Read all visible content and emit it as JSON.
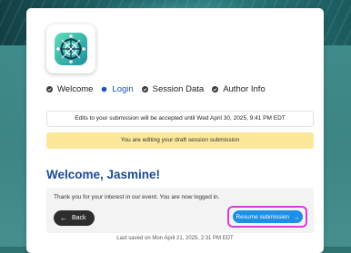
{
  "steps": [
    {
      "label": "Welcome",
      "state": "complete"
    },
    {
      "label": "Login",
      "state": "active"
    },
    {
      "label": "Session Data",
      "state": "complete"
    },
    {
      "label": "Author Info",
      "state": "complete"
    }
  ],
  "notice": "Edits to your submission will be accepted until Wed April 30, 2025, 9:41 PM EDT",
  "banner": "You are editing your draft session submission",
  "welcome": "Welcome, Jasmine!",
  "panel": {
    "message": "Thank you for your interest in our event. You are now logged in.",
    "back_label": "Back",
    "resume_label": "Resume submission"
  },
  "last_saved": "Last saved on Mon April 21, 2025, 2:31 PM EDT",
  "icons": {
    "logo": "event-logo-icon",
    "step_complete": "check-circle-icon",
    "step_active": "dot-icon",
    "back": "arrow-left-icon",
    "resume": "arrow-right-icon"
  },
  "colors": {
    "accent_blue": "#1c4a97",
    "active_step": "#1d53b7",
    "resume_button": "#1c8fe6",
    "highlight_outline": "#d93bd9",
    "banner_bg": "#fbe89a"
  }
}
